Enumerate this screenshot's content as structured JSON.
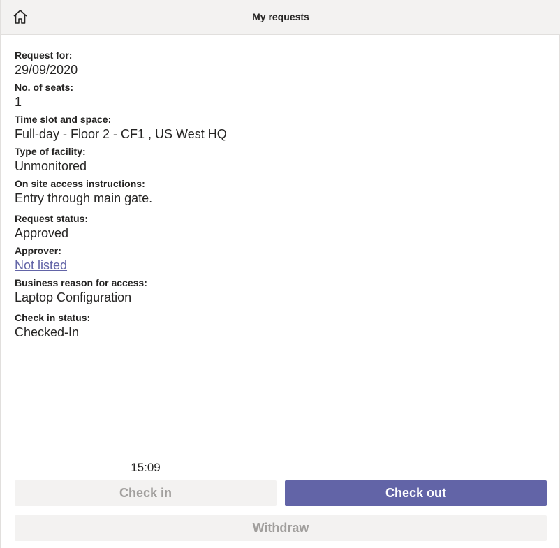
{
  "header": {
    "title": "My requests",
    "home_icon": "home-icon"
  },
  "fields": [
    {
      "label": "Request for:",
      "value": "29/09/2020"
    },
    {
      "label": "No. of seats:",
      "value": "1"
    },
    {
      "label": "Time slot and space:",
      "value": "Full-day - Floor 2 - CF1 , US West HQ"
    },
    {
      "label": "Type of facility:",
      "value": "Unmonitored"
    },
    {
      "label": "On site access instructions:",
      "value": "Entry through main gate."
    },
    {
      "label": "Request status:",
      "value": "Approved"
    },
    {
      "label": "Approver:",
      "value": "Not listed"
    },
    {
      "label": "Business reason for access:",
      "value": "Laptop Configuration"
    },
    {
      "label": "Check in status:",
      "value": "Checked-In"
    }
  ],
  "time": "15:09",
  "buttons": {
    "check_in": "Check in",
    "check_out": "Check out",
    "withdraw": "Withdraw"
  },
  "colors": {
    "accent": "#6264a7",
    "disabled_bg": "#f3f2f1",
    "disabled_text": "#a19f9d",
    "header_bg": "#f3f2f1"
  }
}
